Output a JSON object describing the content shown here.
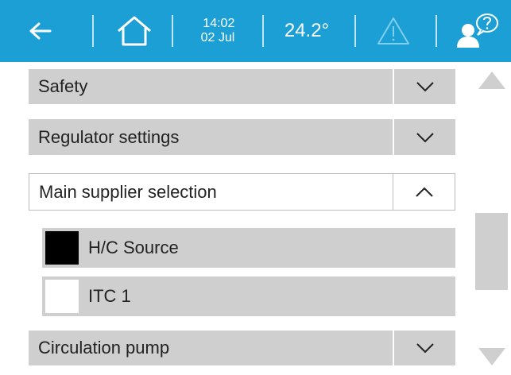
{
  "header": {
    "time": "14:02",
    "date": "02 Jul",
    "temperature": "24.2°"
  },
  "sections": [
    {
      "label": "Safety",
      "state": "collapsed"
    },
    {
      "label": "Regulator settings",
      "state": "collapsed"
    },
    {
      "label": "Main supplier selection",
      "state": "expanded"
    },
    {
      "label": "Circulation pump",
      "state": "collapsed"
    }
  ],
  "options": [
    {
      "label": "H/C Source",
      "selected": true
    },
    {
      "label": "ITC 1",
      "selected": false
    }
  ],
  "scrollbar": {
    "position": 0.7
  },
  "colors": {
    "header": "#1c9fd4",
    "row": "#cfcfcf",
    "selected_box": "#000000"
  }
}
